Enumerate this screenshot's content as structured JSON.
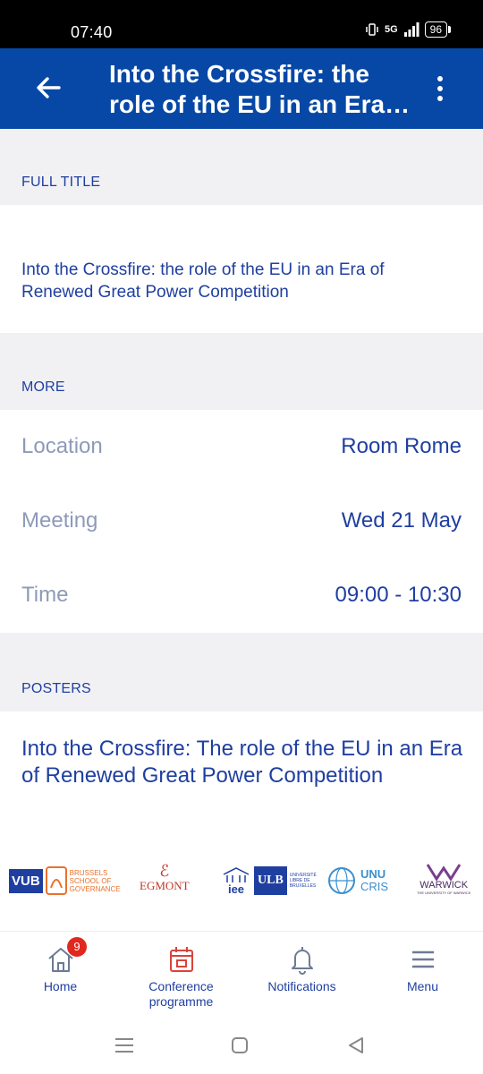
{
  "status_bar": {
    "time": "07:40",
    "network": "5G",
    "battery": "96"
  },
  "app_bar": {
    "title": "Into the Crossfire: the role of the EU in an Era of Renewed Great Power Competition"
  },
  "sections": {
    "full_title_header": "FULL TITLE",
    "full_title_text": "Into the Crossfire: the role of the EU in an Era of Renewed Great Power Competition",
    "more_header": "MORE",
    "posters_header": "POSTERS"
  },
  "details": [
    {
      "label": "Location",
      "value": "Room Rome"
    },
    {
      "label": "Meeting",
      "value": "Wed 21 May"
    },
    {
      "label": "Time",
      "value": "09:00 - 10:30"
    }
  ],
  "poster": {
    "title": "Into the Crossfire: The role of the EU in an Era of Renewed Great Power Competition"
  },
  "sponsors": {
    "vub": "VUB",
    "bsog": "BRUSSELS SCHOOL OF GOVERNANCE",
    "egmont": "EGMONT",
    "iee": "iee",
    "ulb": "ULB",
    "ulb_sub": "UNIVERSITÉ LIBRE DE BRUXELLES",
    "unu": "UNU",
    "cris": "CRIS",
    "warwick": "WARWICK",
    "warwick_sub": "THE UNIVERSITY OF WARWICK"
  },
  "tabs": [
    {
      "label": "Home",
      "badge": "9"
    },
    {
      "label": "Conference programme"
    },
    {
      "label": "Notifications"
    },
    {
      "label": "Menu"
    }
  ],
  "colors": {
    "primary": "#0748a6",
    "text_blue": "#1f3fa0",
    "label_grey": "#8e9ab8",
    "active_tab": "#d9443a",
    "section_bg": "#f1f1f4"
  },
  "icons": [
    "back-arrow-icon",
    "more-vertical-icon",
    "home-icon",
    "calendar-icon",
    "bell-icon",
    "hamburger-menu-icon"
  ]
}
